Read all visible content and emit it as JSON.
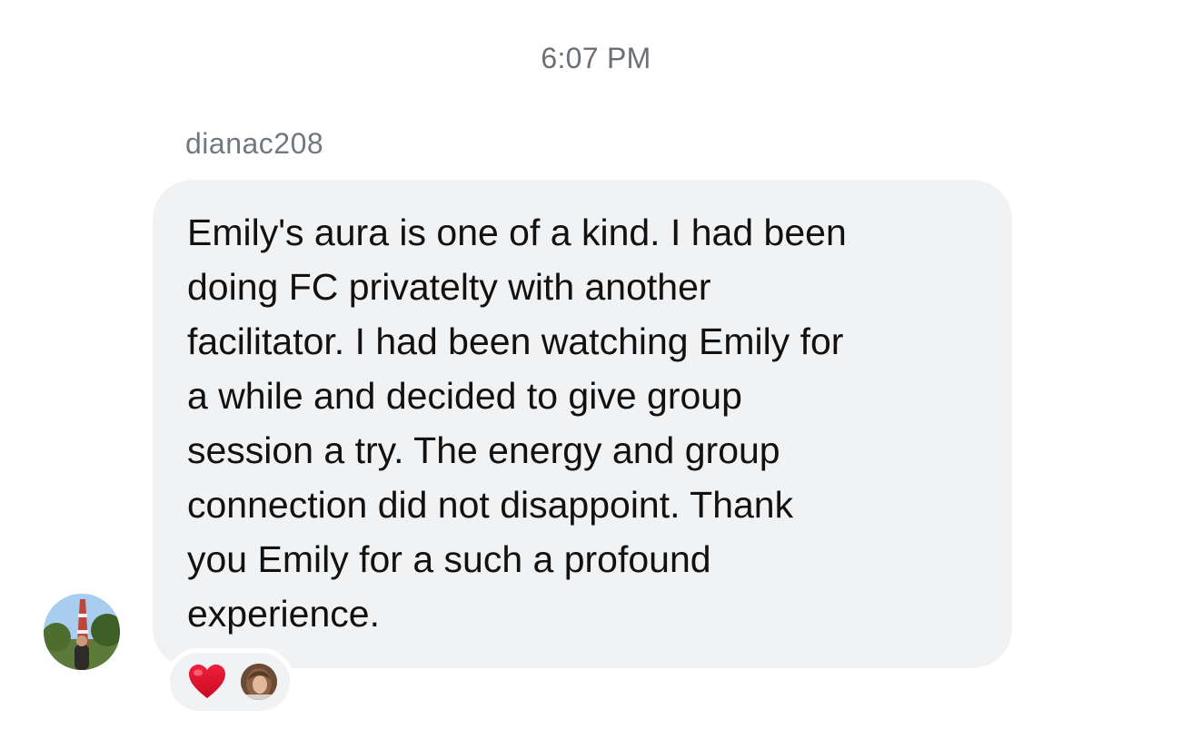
{
  "thread": {
    "timestamp": "6:07 PM"
  },
  "message": {
    "sender": "dianac208",
    "text": "Emily's aura is one of a kind. I had been\ndoing FC privatelty with another\nfacilitator. I had been watching Emily for\na while and decided to give group\nsession a try. The energy and group\nconnection did not disappoint. Thank\nyou Emily for a such a profound\nexperience.",
    "bubble_color": "#f1f2f4",
    "reactions": [
      {
        "emoji": "❤️",
        "icon": "heart-icon",
        "color": "#e0102c"
      }
    ]
  }
}
